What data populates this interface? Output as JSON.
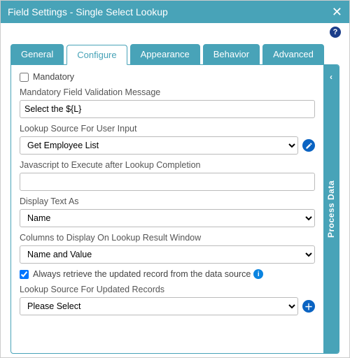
{
  "window": {
    "title": "Field Settings - Single Select Lookup"
  },
  "tabs": {
    "items": [
      {
        "label": "General"
      },
      {
        "label": "Configure"
      },
      {
        "label": "Appearance"
      },
      {
        "label": "Behavior"
      },
      {
        "label": "Advanced"
      }
    ],
    "active_index": 1
  },
  "side_panel": {
    "label": "Process Data"
  },
  "form": {
    "mandatory": {
      "label": "Mandatory",
      "checked": false
    },
    "validation_msg": {
      "label": "Mandatory Field Validation Message",
      "value": "Select the ${L}"
    },
    "lookup_source_user": {
      "label": "Lookup Source For User Input",
      "value": "Get Employee List"
    },
    "js_after_lookup": {
      "label": "Javascript to Execute after Lookup Completion",
      "value": ""
    },
    "display_text_as": {
      "label": "Display Text As",
      "value": "Name"
    },
    "columns_display": {
      "label": "Columns to Display On Lookup Result Window",
      "value": "Name and Value"
    },
    "always_retrieve": {
      "label": "Always retrieve the updated record from the data source",
      "checked": true
    },
    "lookup_source_updated": {
      "label": "Lookup Source For Updated Records",
      "value": "Please Select"
    }
  }
}
